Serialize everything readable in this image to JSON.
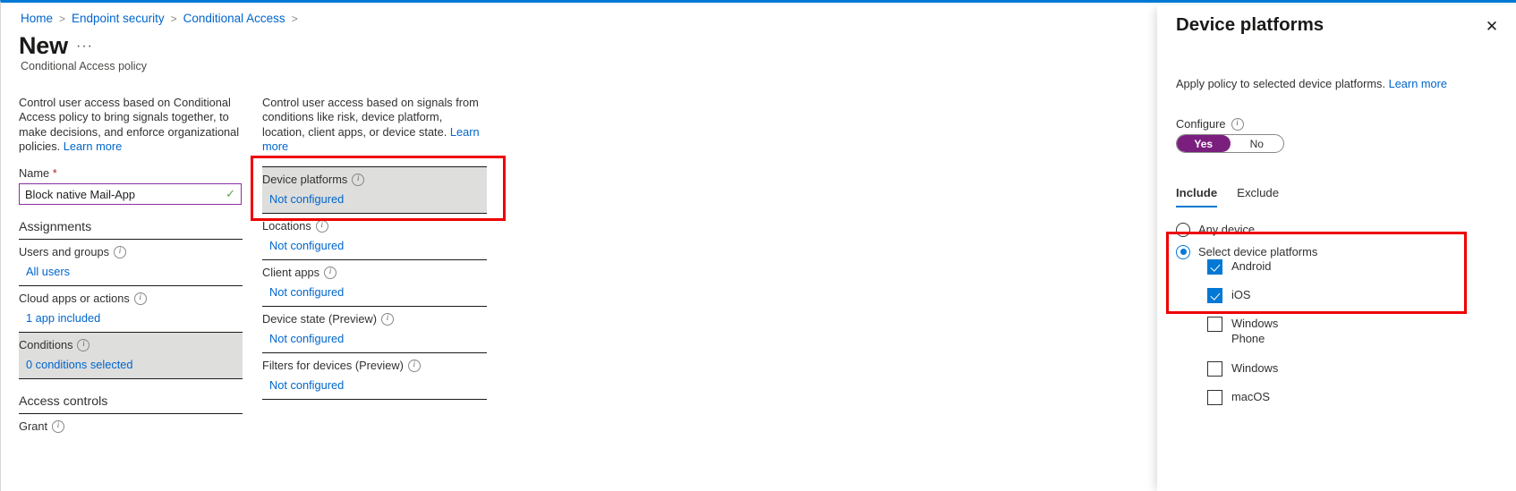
{
  "breadcrumb": {
    "items": [
      "Home",
      "Endpoint security",
      "Conditional Access"
    ],
    "separator": ">"
  },
  "header": {
    "title": "New",
    "ellipsis": "···",
    "subtitle": "Conditional Access policy"
  },
  "left_column": {
    "intro_text": "Control user access based on Conditional Access policy to bring signals together, to make decisions, and enforce organizational policies. ",
    "intro_link": "Learn more",
    "name_label": "Name ",
    "name_required_mark": "*",
    "name_value": "Block native Mail-App",
    "name_valid_icon": "✓",
    "assignments_heading": "Assignments",
    "rows": [
      {
        "label": "Users and groups",
        "value": "All users"
      },
      {
        "label": "Cloud apps or actions",
        "value": "1 app included"
      },
      {
        "label": "Conditions",
        "value": "0 conditions selected"
      }
    ],
    "access_controls_heading": "Access controls",
    "grant_label": "Grant"
  },
  "mid_column": {
    "intro_text": "Control user access based on signals from conditions like risk, device platform, location, client apps, or device state. ",
    "intro_link": "Learn more",
    "rows": [
      {
        "label": "Device platforms",
        "value": "Not configured"
      },
      {
        "label": "Locations",
        "value": "Not configured"
      },
      {
        "label": "Client apps",
        "value": "Not configured"
      },
      {
        "label": "Device state (Preview)",
        "value": "Not configured"
      },
      {
        "label": "Filters for devices (Preview)",
        "value": "Not configured"
      }
    ]
  },
  "flyout": {
    "title": "Device platforms",
    "close_icon": "✕",
    "description": "Apply policy to selected device platforms. ",
    "description_link": "Learn more",
    "configure_label": "Configure",
    "toggle": {
      "yes": "Yes",
      "no": "No",
      "selected": "Yes"
    },
    "tabs": [
      {
        "label": "Include",
        "active": true
      },
      {
        "label": "Exclude",
        "active": false
      }
    ],
    "radios": [
      {
        "label": "Any device",
        "selected": false
      },
      {
        "label": "Select device platforms",
        "selected": true
      }
    ],
    "checkboxes": [
      {
        "label": "Android",
        "checked": true
      },
      {
        "label": "iOS",
        "checked": true
      },
      {
        "label": "Windows Phone",
        "checked": false
      },
      {
        "label": "Windows",
        "checked": false
      },
      {
        "label": "macOS",
        "checked": false
      }
    ]
  },
  "colors": {
    "accent_blue": "#0078d4",
    "link_blue": "#0066cc",
    "purple_toggle": "#7b1f7f",
    "input_border_purple": "#8b2fa0",
    "annotation_red": "#ee0000",
    "highlight_gray": "#dededd",
    "valid_green": "#5aa545"
  }
}
